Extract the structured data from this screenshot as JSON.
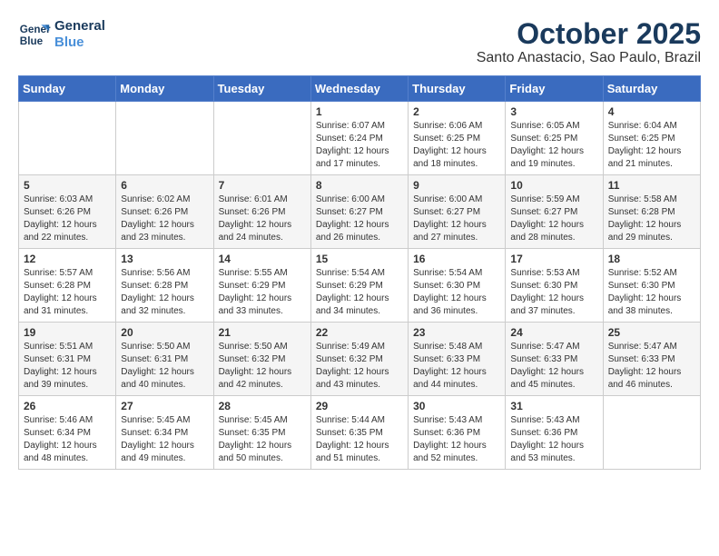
{
  "header": {
    "logo_line1": "General",
    "logo_line2": "Blue",
    "title": "October 2025",
    "subtitle": "Santo Anastacio, Sao Paulo, Brazil"
  },
  "calendar": {
    "weekdays": [
      "Sunday",
      "Monday",
      "Tuesday",
      "Wednesday",
      "Thursday",
      "Friday",
      "Saturday"
    ],
    "weeks": [
      [
        {
          "day": "",
          "info": ""
        },
        {
          "day": "",
          "info": ""
        },
        {
          "day": "",
          "info": ""
        },
        {
          "day": "1",
          "info": "Sunrise: 6:07 AM\nSunset: 6:24 PM\nDaylight: 12 hours\nand 17 minutes."
        },
        {
          "day": "2",
          "info": "Sunrise: 6:06 AM\nSunset: 6:25 PM\nDaylight: 12 hours\nand 18 minutes."
        },
        {
          "day": "3",
          "info": "Sunrise: 6:05 AM\nSunset: 6:25 PM\nDaylight: 12 hours\nand 19 minutes."
        },
        {
          "day": "4",
          "info": "Sunrise: 6:04 AM\nSunset: 6:25 PM\nDaylight: 12 hours\nand 21 minutes."
        }
      ],
      [
        {
          "day": "5",
          "info": "Sunrise: 6:03 AM\nSunset: 6:26 PM\nDaylight: 12 hours\nand 22 minutes."
        },
        {
          "day": "6",
          "info": "Sunrise: 6:02 AM\nSunset: 6:26 PM\nDaylight: 12 hours\nand 23 minutes."
        },
        {
          "day": "7",
          "info": "Sunrise: 6:01 AM\nSunset: 6:26 PM\nDaylight: 12 hours\nand 24 minutes."
        },
        {
          "day": "8",
          "info": "Sunrise: 6:00 AM\nSunset: 6:27 PM\nDaylight: 12 hours\nand 26 minutes."
        },
        {
          "day": "9",
          "info": "Sunrise: 6:00 AM\nSunset: 6:27 PM\nDaylight: 12 hours\nand 27 minutes."
        },
        {
          "day": "10",
          "info": "Sunrise: 5:59 AM\nSunset: 6:27 PM\nDaylight: 12 hours\nand 28 minutes."
        },
        {
          "day": "11",
          "info": "Sunrise: 5:58 AM\nSunset: 6:28 PM\nDaylight: 12 hours\nand 29 minutes."
        }
      ],
      [
        {
          "day": "12",
          "info": "Sunrise: 5:57 AM\nSunset: 6:28 PM\nDaylight: 12 hours\nand 31 minutes."
        },
        {
          "day": "13",
          "info": "Sunrise: 5:56 AM\nSunset: 6:28 PM\nDaylight: 12 hours\nand 32 minutes."
        },
        {
          "day": "14",
          "info": "Sunrise: 5:55 AM\nSunset: 6:29 PM\nDaylight: 12 hours\nand 33 minutes."
        },
        {
          "day": "15",
          "info": "Sunrise: 5:54 AM\nSunset: 6:29 PM\nDaylight: 12 hours\nand 34 minutes."
        },
        {
          "day": "16",
          "info": "Sunrise: 5:54 AM\nSunset: 6:30 PM\nDaylight: 12 hours\nand 36 minutes."
        },
        {
          "day": "17",
          "info": "Sunrise: 5:53 AM\nSunset: 6:30 PM\nDaylight: 12 hours\nand 37 minutes."
        },
        {
          "day": "18",
          "info": "Sunrise: 5:52 AM\nSunset: 6:30 PM\nDaylight: 12 hours\nand 38 minutes."
        }
      ],
      [
        {
          "day": "19",
          "info": "Sunrise: 5:51 AM\nSunset: 6:31 PM\nDaylight: 12 hours\nand 39 minutes."
        },
        {
          "day": "20",
          "info": "Sunrise: 5:50 AM\nSunset: 6:31 PM\nDaylight: 12 hours\nand 40 minutes."
        },
        {
          "day": "21",
          "info": "Sunrise: 5:50 AM\nSunset: 6:32 PM\nDaylight: 12 hours\nand 42 minutes."
        },
        {
          "day": "22",
          "info": "Sunrise: 5:49 AM\nSunset: 6:32 PM\nDaylight: 12 hours\nand 43 minutes."
        },
        {
          "day": "23",
          "info": "Sunrise: 5:48 AM\nSunset: 6:33 PM\nDaylight: 12 hours\nand 44 minutes."
        },
        {
          "day": "24",
          "info": "Sunrise: 5:47 AM\nSunset: 6:33 PM\nDaylight: 12 hours\nand 45 minutes."
        },
        {
          "day": "25",
          "info": "Sunrise: 5:47 AM\nSunset: 6:33 PM\nDaylight: 12 hours\nand 46 minutes."
        }
      ],
      [
        {
          "day": "26",
          "info": "Sunrise: 5:46 AM\nSunset: 6:34 PM\nDaylight: 12 hours\nand 48 minutes."
        },
        {
          "day": "27",
          "info": "Sunrise: 5:45 AM\nSunset: 6:34 PM\nDaylight: 12 hours\nand 49 minutes."
        },
        {
          "day": "28",
          "info": "Sunrise: 5:45 AM\nSunset: 6:35 PM\nDaylight: 12 hours\nand 50 minutes."
        },
        {
          "day": "29",
          "info": "Sunrise: 5:44 AM\nSunset: 6:35 PM\nDaylight: 12 hours\nand 51 minutes."
        },
        {
          "day": "30",
          "info": "Sunrise: 5:43 AM\nSunset: 6:36 PM\nDaylight: 12 hours\nand 52 minutes."
        },
        {
          "day": "31",
          "info": "Sunrise: 5:43 AM\nSunset: 6:36 PM\nDaylight: 12 hours\nand 53 minutes."
        },
        {
          "day": "",
          "info": ""
        }
      ]
    ]
  }
}
